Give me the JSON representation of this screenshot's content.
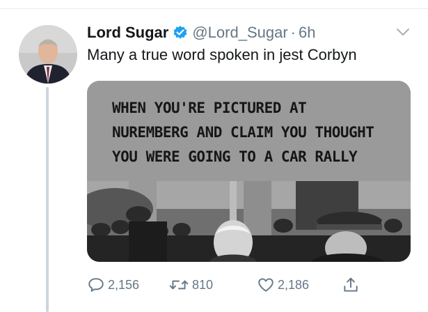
{
  "tweet": {
    "author": {
      "display_name": "Lord Sugar",
      "handle": "@Lord_Sugar",
      "verified": true
    },
    "separator": "·",
    "time": "6h",
    "text": "Many a true word spoken in jest Corbyn",
    "media": {
      "caption_lines": [
        "WHEN YOU'RE PICTURED AT",
        "NUREMBERG AND CLAIM YOU THOUGHT",
        "YOU WERE GOING TO A CAR RALLY"
      ]
    },
    "actions": {
      "reply_count": "2,156",
      "retweet_count": "810",
      "like_count": "2,186"
    }
  },
  "colors": {
    "verified": "#1da1f2",
    "secondary_text": "#657786",
    "thread_line": "#ccd6dd"
  },
  "icons": [
    "verified-icon",
    "chevron-down-icon",
    "reply-icon",
    "retweet-icon",
    "like-icon",
    "share-icon"
  ]
}
